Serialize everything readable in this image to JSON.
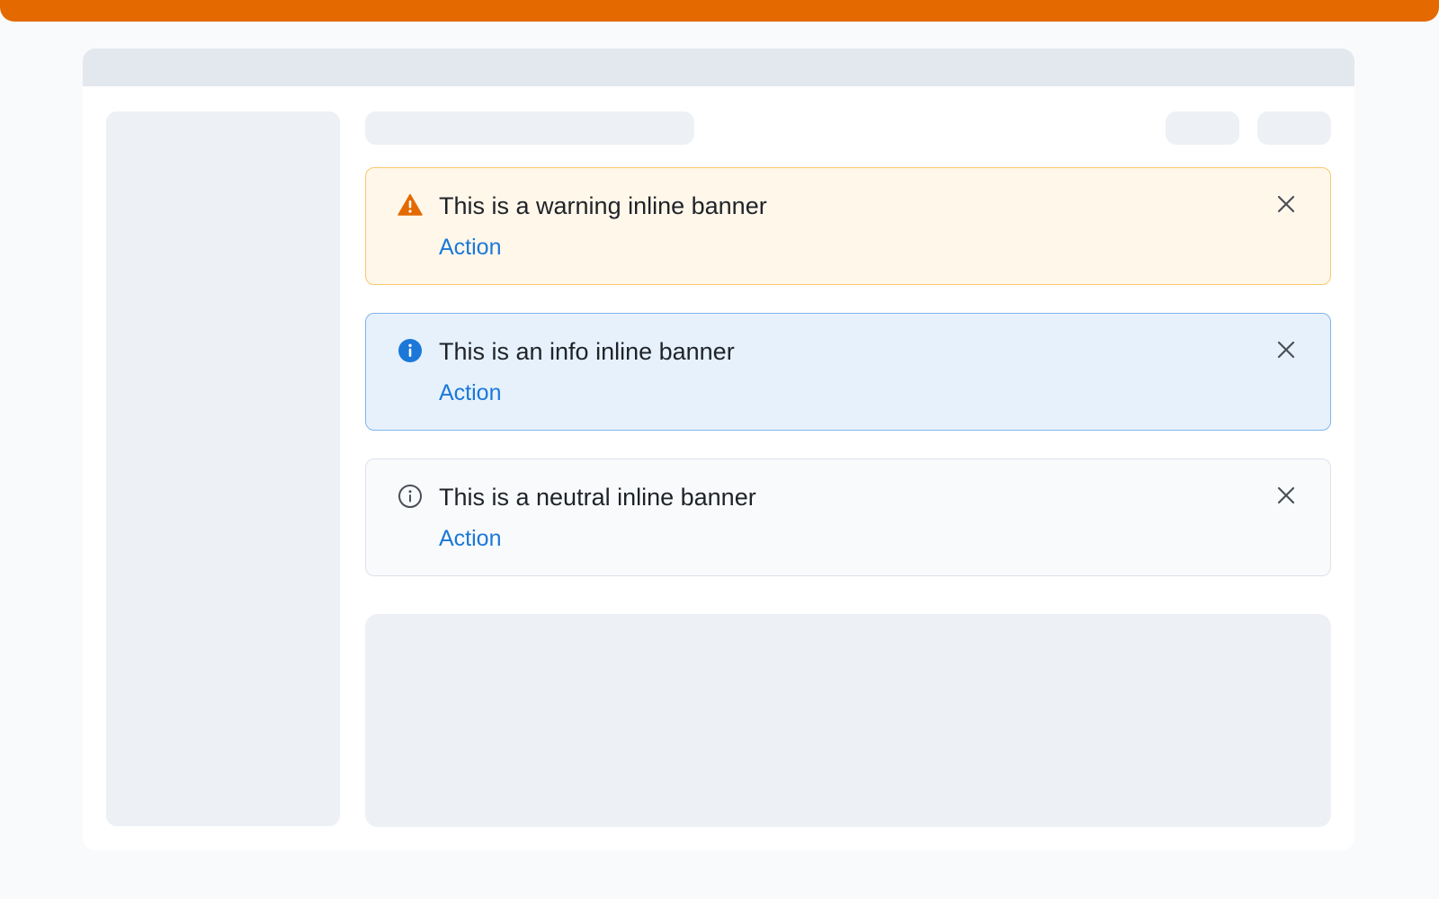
{
  "banners": [
    {
      "variant": "warning",
      "icon": "warning-triangle-icon",
      "message": "This is a warning inline banner",
      "action_label": "Action",
      "close_icon": "close-icon"
    },
    {
      "variant": "info",
      "icon": "info-filled-icon",
      "message": "This is an info inline banner",
      "action_label": "Action",
      "close_icon": "close-icon"
    },
    {
      "variant": "neutral",
      "icon": "info-outline-icon",
      "message": "This is a neutral inline banner",
      "action_label": "Action",
      "close_icon": "close-icon"
    }
  ],
  "colors": {
    "accent": "#e46a00",
    "warning_background": "#fff7ea",
    "warning_border": "#f8c96c",
    "info_background": "#e6f1fc",
    "info_border": "#7fb6ee",
    "neutral_background": "#f8fafc",
    "neutral_border": "#dde2ea",
    "action_link": "#1b78d8",
    "placeholder": "#edf0f4"
  }
}
